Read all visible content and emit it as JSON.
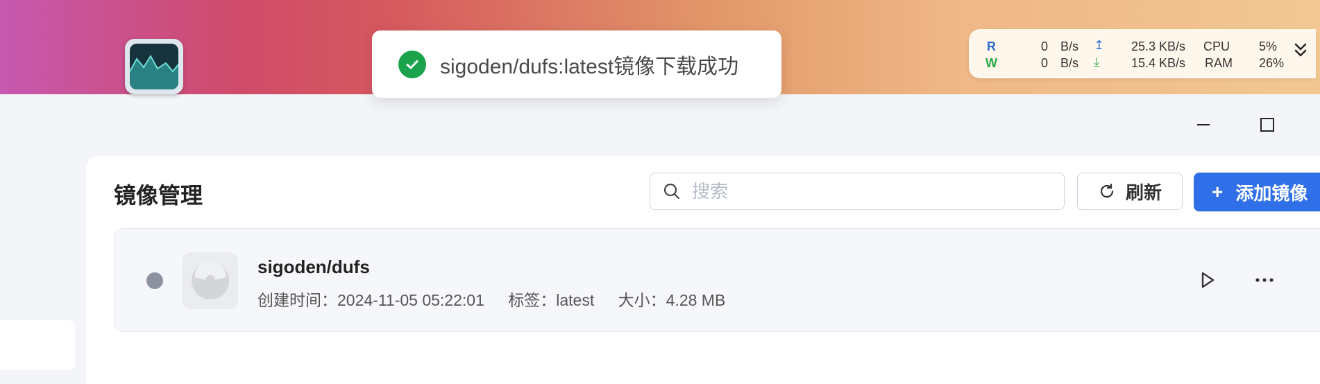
{
  "toast": {
    "message": "sigoden/dufs:latest镜像下载成功",
    "status_color": "#1aa34a"
  },
  "monitor": {
    "read_label": "R",
    "write_label": "W",
    "read_rate": "0",
    "read_unit": "B/s",
    "write_rate": "0",
    "write_unit": "B/s",
    "upload": "25.3 KB/s",
    "download": "15.4 KB/s",
    "cpu_label": "CPU",
    "cpu_value": "5%",
    "ram_label": "RAM",
    "ram_value": "26%",
    "expand_icon": "double-chevron-down-icon"
  },
  "window": {
    "minimize_icon": "minimize-icon",
    "maximize_icon": "maximize-icon"
  },
  "panel": {
    "title": "镜像管理",
    "search_placeholder": "搜索",
    "search_value": "",
    "refresh_label": "刷新",
    "add_label": "添加镜像",
    "accent_color": "#2f6fe8"
  },
  "images": [
    {
      "name": "sigoden/dufs",
      "created": "创建时间：2024-11-05 05:22:01",
      "tag": "标签：latest",
      "size": "大小：4.28 MB",
      "status": "stopped"
    }
  ]
}
